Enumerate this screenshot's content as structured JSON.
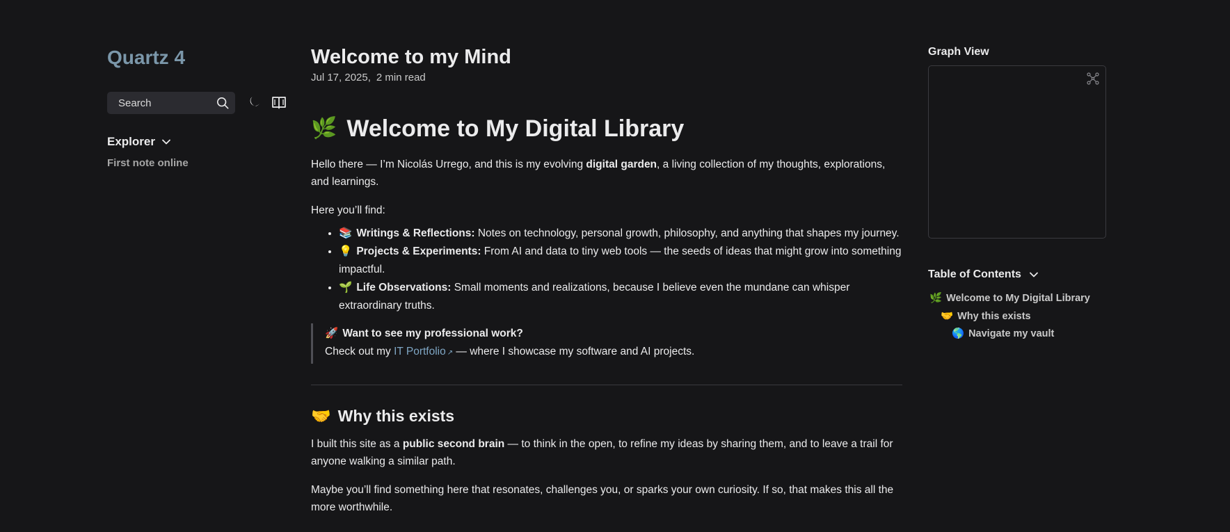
{
  "sidebar": {
    "site_title": "Quartz 4",
    "search_label": "Search",
    "explorer_label": "Explorer",
    "explorer_items": [
      "First note online"
    ]
  },
  "article": {
    "title": "Welcome to my Mind",
    "date": "Jul 17, 2025,",
    "read_time": "2 min read",
    "h1_emoji": "🌿",
    "h1_text": "Welcome to My Digital Library",
    "intro_pre": "Hello there — I’m Nicolás Urrego, and this is my evolving ",
    "intro_bold": "digital garden",
    "intro_post": ", a living collection of my thoughts, explorations, and learnings.",
    "find_label": "Here you’ll find:",
    "find_items": [
      {
        "emoji": "📚",
        "bold": "Writings & Reflections:",
        "text": " Notes on technology, personal growth, philosophy, and anything that shapes my journey."
      },
      {
        "emoji": "💡",
        "bold": "Projects & Experiments:",
        "text": " From AI and data to tiny web tools — the seeds of ideas that might grow into something impactful."
      },
      {
        "emoji": "🌱",
        "bold": "Life Observations:",
        "text": " Small moments and realizations, because I believe even the mundane can whisper extraordinary truths."
      }
    ],
    "quote": {
      "emoji": "🚀",
      "title": "Want to see my professional work?",
      "pre": "Check out my ",
      "link": "IT Portfolio",
      "post": " — where I showcase my software and AI projects."
    },
    "h2_emoji": "🤝",
    "h2_text": "Why this exists",
    "why_pre": "I built this site as a ",
    "why_bold": "public second brain",
    "why_post": " — to think in the open, to refine my ideas by sharing them, and to leave a trail for anyone walking a similar path.",
    "maybe": "Maybe you’ll find something here that resonates, challenges you, or sparks your own curiosity. If so, that makes this all the more worthwhile."
  },
  "right": {
    "graph_title": "Graph View",
    "toc_title": "Table of Contents",
    "toc": [
      {
        "emoji": "🌿",
        "text": "Welcome to My Digital Library",
        "depth": 1
      },
      {
        "emoji": "🤝",
        "text": "Why this exists",
        "depth": 2
      },
      {
        "emoji": "🌎",
        "text": "Navigate my vault",
        "depth": 3
      }
    ]
  },
  "colors": {
    "background": "#161618",
    "title_accent": "#7b97aa",
    "link": "#7fa6c4"
  },
  "icons": {
    "search": "search-icon",
    "darkmode": "moon-icon",
    "reader": "book-icon",
    "explorer": "chevron-down-icon",
    "graph_expand": "expand-graph-icon",
    "toc": "chevron-down-icon"
  }
}
